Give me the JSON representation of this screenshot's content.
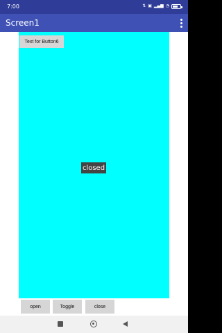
{
  "status_bar": {
    "time": "7:00",
    "icons": [
      "data-speed-icon",
      "sim-icon",
      "signal-icon",
      "wifi-icon",
      "battery-icon"
    ],
    "battery_level": 0.6
  },
  "app_bar": {
    "title": "Screen1"
  },
  "main": {
    "background_color": "#00ffff",
    "button6_label": "Text for Button6",
    "status_label": "closed"
  },
  "bottom_buttons": {
    "open_label": "open",
    "toggle_label": "Toggle",
    "close_label": "close"
  },
  "nav_bar": {
    "icons": [
      "recents-icon",
      "home-icon",
      "back-icon"
    ]
  }
}
